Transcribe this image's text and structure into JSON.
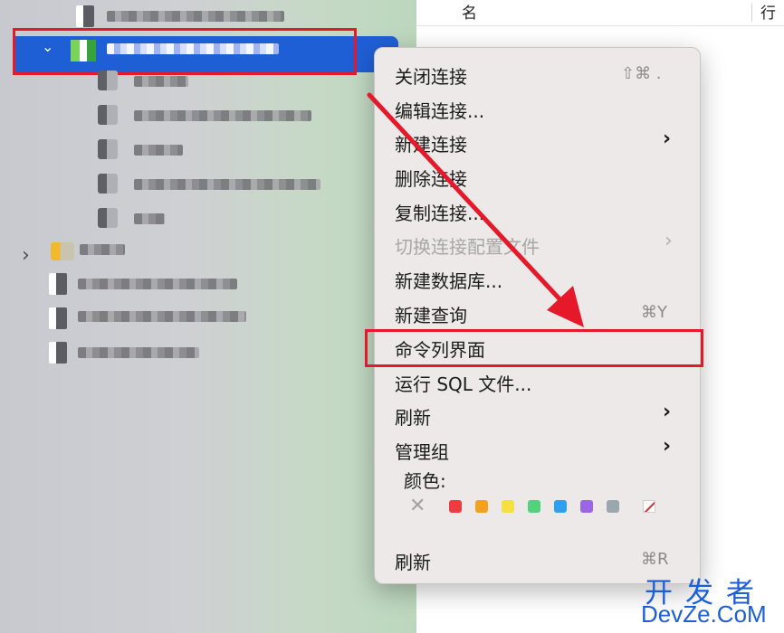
{
  "table_header": {
    "name_col": "名",
    "rows_col": "行"
  },
  "context_menu": {
    "items": [
      {
        "label": "关闭连接",
        "shortcut": "⇧⌘ .",
        "submenu": false,
        "disabled": false
      },
      {
        "label": "编辑连接...",
        "shortcut": "",
        "submenu": false,
        "disabled": false
      },
      {
        "label": "新建连接",
        "shortcut": "",
        "submenu": true,
        "disabled": false
      },
      {
        "label": "删除连接",
        "shortcut": "",
        "submenu": false,
        "disabled": false
      },
      {
        "label": "复制连接...",
        "shortcut": "",
        "submenu": false,
        "disabled": false
      },
      {
        "label": "切换连接配置文件",
        "shortcut": "",
        "submenu": true,
        "disabled": true
      },
      {
        "label": "新建数据库...",
        "shortcut": "",
        "submenu": false,
        "disabled": false
      },
      {
        "label": "新建查询",
        "shortcut": "⌘Y",
        "submenu": false,
        "disabled": false
      },
      {
        "label": "命令列界面",
        "shortcut": "",
        "submenu": false,
        "disabled": false
      },
      {
        "label": "运行 SQL 文件...",
        "shortcut": "",
        "submenu": false,
        "disabled": false
      },
      {
        "label": "刷新",
        "shortcut": "",
        "submenu": true,
        "disabled": false
      },
      {
        "label": "管理组",
        "shortcut": "",
        "submenu": true,
        "disabled": false
      }
    ],
    "color_label": "颜色:",
    "colors": [
      "#ef3b3f",
      "#f4a11f",
      "#f4e040",
      "#52d27c",
      "#2f9ff2",
      "#9a66e6",
      "#9aa7ad"
    ],
    "no_color_symbol": "✕",
    "refresh": {
      "label": "刷新",
      "shortcut": "⌘R"
    },
    "submenu_arrow": "›"
  },
  "sidebar": {
    "expand_chevron": "›",
    "collapse_chevron": "⌄"
  },
  "watermark": {
    "line1": "开发者",
    "line2": "DevZe.CoM"
  }
}
